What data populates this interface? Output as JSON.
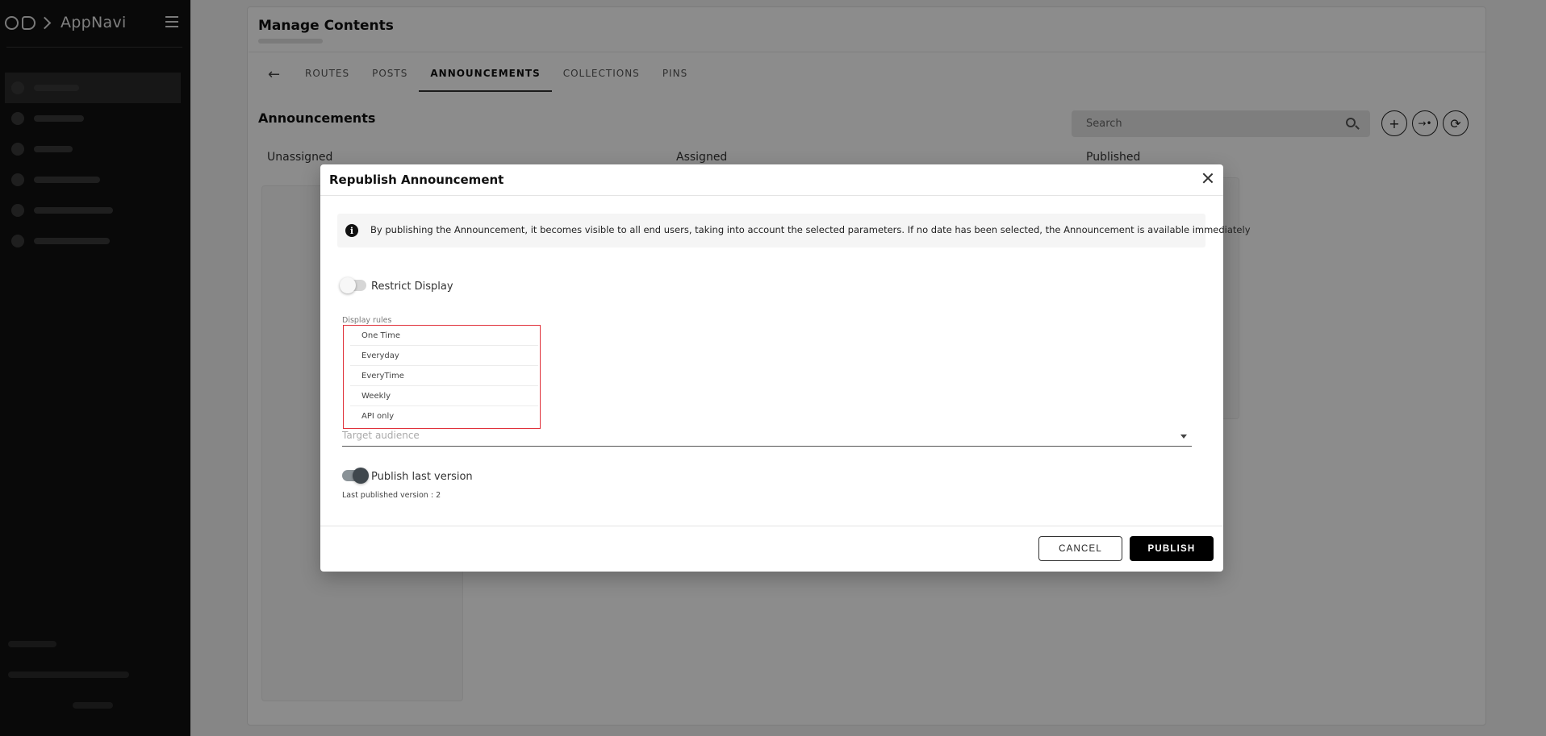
{
  "app": {
    "name": "AppNavi"
  },
  "page": {
    "title": "Manage Contents",
    "tabs": [
      {
        "label": "ROUTES"
      },
      {
        "label": "POSTS"
      },
      {
        "label": "ANNOUNCEMENTS",
        "active": true
      },
      {
        "label": "COLLECTIONS"
      },
      {
        "label": "PINS"
      }
    ],
    "section_title": "Announcements",
    "search_placeholder": "Search",
    "columns": [
      "Unassigned",
      "Assigned",
      "Published"
    ]
  },
  "icons": {
    "back": "arrow-left-icon",
    "search": "search-icon",
    "add": "plus-icon",
    "move": "arrow-right-dot-icon",
    "refresh": "refresh-icon",
    "close": "close-icon",
    "info": "info-icon",
    "caret": "caret-down-icon",
    "menu": "hamburger-menu-icon"
  },
  "modal": {
    "title": "Republish Announcement",
    "info_text": "By publishing the Announcement, it becomes visible to all end users, taking into account the selected parameters. If no date has been selected, the Announcement is available immediately",
    "restrict_display": {
      "label": "Restrict Display",
      "on": false
    },
    "display_rules": {
      "label": "Display rules",
      "options": [
        "One Time",
        "Everyday",
        "EveryTime",
        "Weekly",
        "API only"
      ]
    },
    "target_audience_placeholder": "Target audience",
    "publish_last_version": {
      "label": "Publish last version",
      "on": true
    },
    "last_published_version": "Last published version : 2",
    "cancel_label": "CANCEL",
    "publish_label": "PUBLISH"
  },
  "colors": {
    "sidebar_bg": "#111111",
    "dropdown_highlight": "#e0313a",
    "primary_button": "#000000"
  }
}
